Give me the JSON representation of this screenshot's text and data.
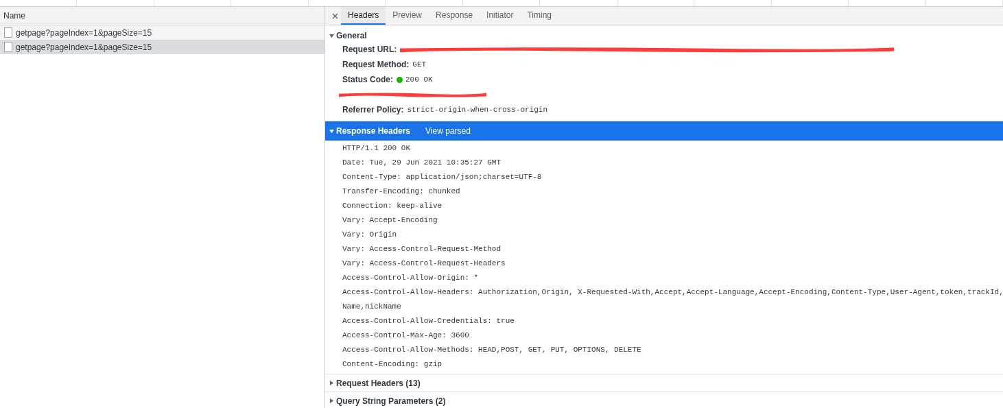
{
  "requests": {
    "column": "Name",
    "rows": [
      {
        "name": "getpage?pageIndex=1&pageSize=15",
        "selected": false
      },
      {
        "name": "getpage?pageIndex=1&pageSize=15",
        "selected": true
      }
    ]
  },
  "tabs": [
    {
      "label": "Headers",
      "selected": true
    },
    {
      "label": "Preview",
      "selected": false
    },
    {
      "label": "Response",
      "selected": false
    },
    {
      "label": "Initiator",
      "selected": false
    },
    {
      "label": "Timing",
      "selected": false
    }
  ],
  "general": {
    "title": "General",
    "expanded": true,
    "rows": [
      {
        "label": "Request URL:",
        "redacted": true
      },
      {
        "label": "Request Method:",
        "value": "GET",
        "redacted": false
      },
      {
        "label": "Status Code:",
        "value": "200 OK",
        "color": "#1db100",
        "redacted": false
      },
      {
        "redacted": true
      },
      {
        "label": "Referrer Policy:",
        "value": "strict-origin-when-cross-origin",
        "redacted": false
      }
    ]
  },
  "response_headers": {
    "title": "Response Headers",
    "action": "View parsed",
    "expanded": true,
    "highlighted": true,
    "lines": [
      "HTTP/1.1 200 OK",
      "Date: Tue, 29 Jun 2021 10:35:27 GMT",
      "Content-Type: application/json;charset=UTF-8",
      "Transfer-Encoding: chunked",
      "Connection: keep-alive",
      "Vary: Accept-Encoding",
      "Vary: Origin",
      "Vary: Access-Control-Request-Method",
      "Vary: Access-Control-Request-Headers",
      "Access-Control-Allow-Origin: *",
      "Access-Control-Allow-Headers: Authorization,Origin, X-Requested-With,Accept,Accept-Language,Accept-Encoding,Content-Type,User-Agent,token,trackId,",
      "Name,nickName",
      "Access-Control-Allow-Credentials: true",
      "Access-Control-Max-Age: 3600",
      "Access-Control-Allow-Methods: HEAD,POST, GET, PUT, OPTIONS, DELETE",
      "Content-Encoding: gzip"
    ]
  },
  "collapsed_sections": [
    {
      "title": "Request Headers (13)",
      "expanded": false
    },
    {
      "title": "Query String Parameters (2)",
      "expanded": false
    }
  ]
}
